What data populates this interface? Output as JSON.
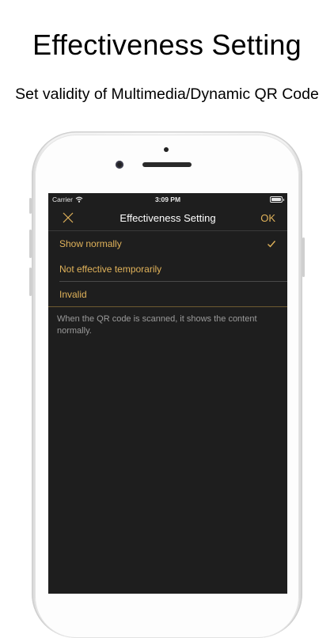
{
  "promo": {
    "title": "Effectiveness Setting",
    "subtitle": "Set validity of Multimedia/Dynamic QR Code"
  },
  "status_bar": {
    "carrier": "Carrier",
    "time": "3:09 PM",
    "wifi_icon": "wifi-icon",
    "battery_icon": "battery-icon"
  },
  "navbar": {
    "close_icon": "close-icon",
    "title": "Effectiveness Setting",
    "ok_label": "OK"
  },
  "options": [
    {
      "label": "Show normally",
      "selected": true
    },
    {
      "label": "Not effective temporarily",
      "selected": false
    },
    {
      "label": "Invalid",
      "selected": false
    }
  ],
  "description": "When the QR code is scanned, it shows the content normally.",
  "colors": {
    "accent": "#e0b25a",
    "screen_bg": "#1e1e1e",
    "description_text": "#9a9a9a"
  }
}
